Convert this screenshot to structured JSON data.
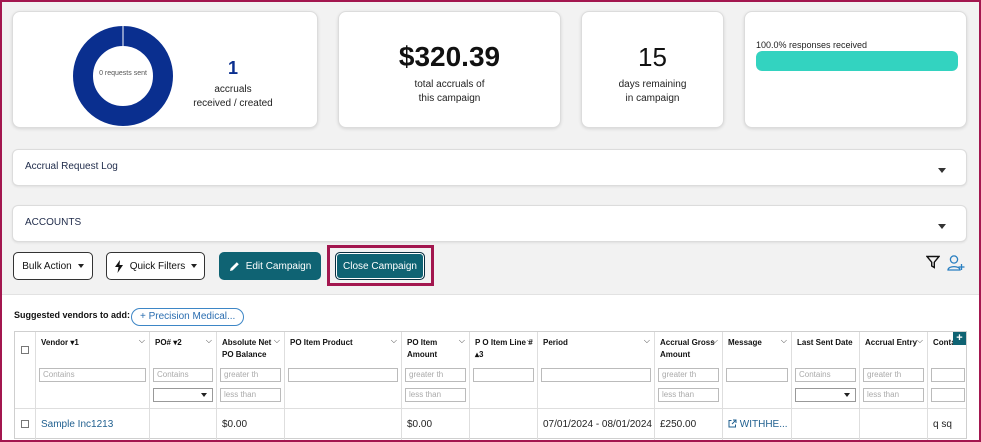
{
  "stats": {
    "donut_label": "0 requests sent",
    "donut_color": "#0a2f8f",
    "accruals_count": "1",
    "accruals_label_1": "accruals",
    "accruals_label_2": "received / created",
    "total_amount": "$320.39",
    "total_label_1": "total accruals of",
    "total_label_2": "this campaign",
    "days_count": "15",
    "days_label_1": "days remaining",
    "days_label_2": "in campaign",
    "responses_label": "100.0% responses received",
    "responses_fraction": 1.0,
    "responses_color": "#33d3c0"
  },
  "accordions": {
    "log_title": "Accrual Request Log",
    "accounts_title": "ACCOUNTS"
  },
  "toolbar": {
    "bulk_action": "Bulk Action",
    "quick_filters": "Quick Filters",
    "edit_campaign": "Edit Campaign",
    "close_campaign": "Close Campaign",
    "highlight_color": "#a3174f"
  },
  "suggested": {
    "label": "Suggested vendors to add:",
    "chip": "+ Precision Medical..."
  },
  "table": {
    "headers": {
      "vendor": "Vendor",
      "vendor_sort": "▾1",
      "po": "PO#",
      "po_sort": "▾2",
      "abs_net_1": "Absolute Net",
      "abs_net_2": "PO Balance",
      "po_item_product": "PO Item Product",
      "po_item_amount_1": "PO Item",
      "po_item_amount_2": "Amount",
      "po_line_1": "P O Item Line #",
      "po_line_2": "▴3",
      "period": "Period",
      "accrual_gross_1": "Accrual Gross",
      "accrual_gross_2": "Amount",
      "message": "Message",
      "last_sent": "Last Sent Date",
      "accrual_entry": "Accrual Entry",
      "contact": "Conta"
    },
    "filters": {
      "contains": "Contains",
      "greater": "greater th",
      "less": "less than"
    },
    "row": {
      "vendor": "Sample Inc1213",
      "abs_net": "$0.00",
      "po_item_amount": "$0.00",
      "period": "07/01/2024 - 08/01/2024",
      "accrual_gross": "£250.00",
      "message": "WITHHE...",
      "contact": "q sq"
    }
  }
}
